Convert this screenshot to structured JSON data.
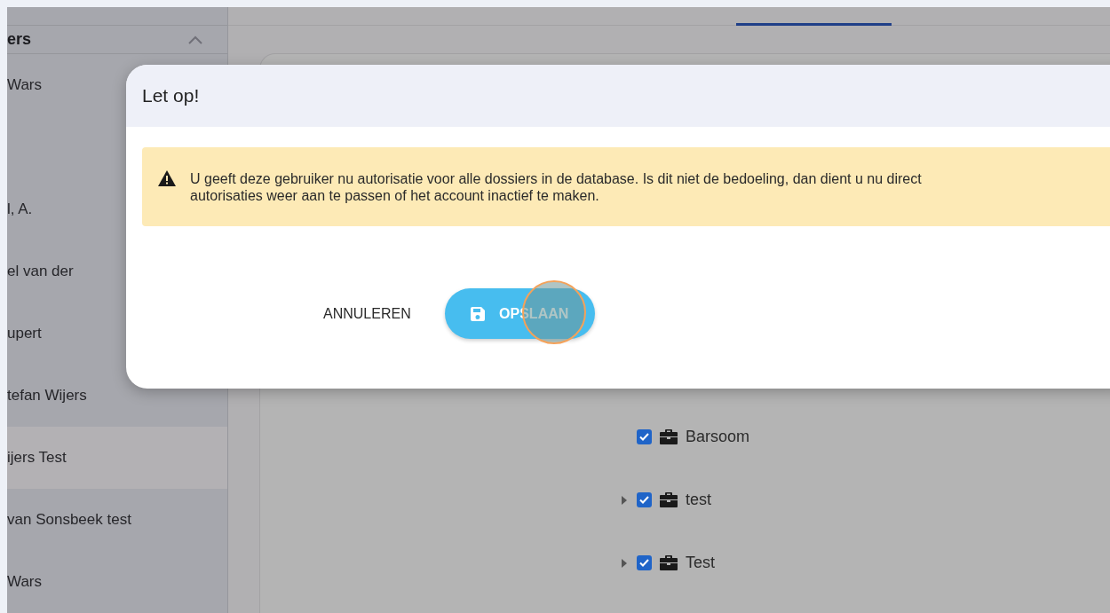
{
  "sidebar": {
    "header": "ers",
    "expanded": true,
    "items": [
      {
        "label": "Wars",
        "selected": false
      },
      {
        "selected": false
      },
      {
        "label": "l, A.",
        "selected": false
      },
      {
        "label": "el van der",
        "selected": false
      },
      {
        "label": "upert",
        "selected": false
      },
      {
        "label": "tefan Wijers",
        "selected": false
      },
      {
        "label": "ijers Test",
        "selected": true
      },
      {
        "label": "van Sonsbeek test",
        "selected": false
      },
      {
        "label": "Wars",
        "selected": false
      }
    ]
  },
  "tree": [
    {
      "label": "Barsoom",
      "checked": true,
      "has_children": false
    },
    {
      "label": "test",
      "checked": true,
      "has_children": true
    },
    {
      "label": "Test",
      "checked": true,
      "has_children": true
    }
  ],
  "dialog": {
    "title": "Let op!",
    "alert_lines": [
      "U geeft deze gebruiker nu autorisatie voor alle dossiers in de database. Is dit niet de bedoeling, dan dient u nu direct",
      "autorisaties weer aan te passen of het account inactief te maken."
    ],
    "cancel": "ANNULEREN",
    "save": "OPSLAAN",
    "click_marker": true
  }
}
